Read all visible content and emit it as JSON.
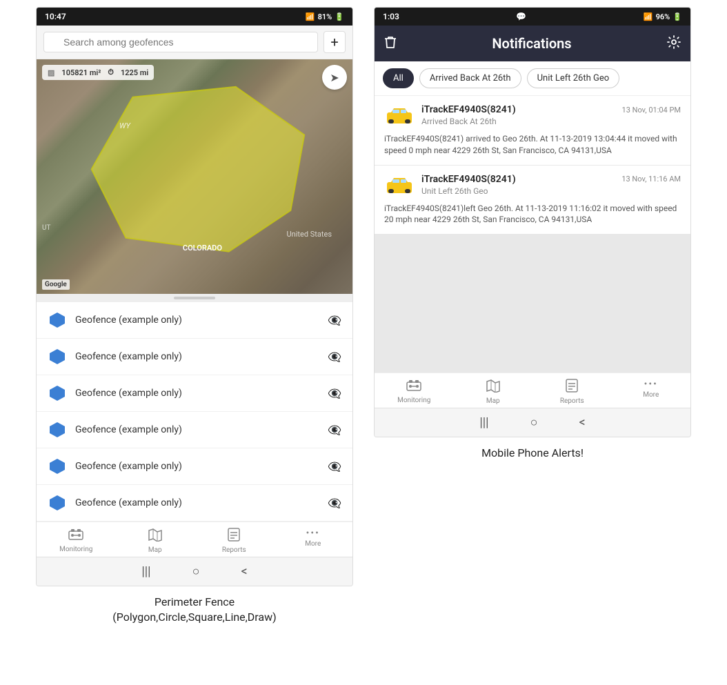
{
  "left_phone": {
    "status_bar": {
      "time": "10:47",
      "wifi": "WiFi",
      "signal": "📶",
      "battery": "81%"
    },
    "search": {
      "placeholder": "Search among geofences",
      "add_button": "+"
    },
    "map": {
      "area": "105821 mi²",
      "distance": "1225 mi",
      "label_wy": "WY",
      "label_ut": "UT",
      "label_us": "United States",
      "label_colorado": "COLORADO",
      "google": "Google"
    },
    "geofence_items": [
      {
        "label": "Geofence (example only)"
      },
      {
        "label": "Geofence (example only)"
      },
      {
        "label": "Geofence (example only)"
      },
      {
        "label": "Geofence (example only)"
      },
      {
        "label": "Geofence (example only)"
      },
      {
        "label": "Geofence (example only)"
      }
    ],
    "bottom_nav": [
      {
        "label": "Monitoring",
        "icon": "🚌"
      },
      {
        "label": "Map",
        "icon": "🗺"
      },
      {
        "label": "Reports",
        "icon": "📊"
      },
      {
        "label": "More",
        "icon": "•••"
      }
    ],
    "android_nav": [
      "|||",
      "○",
      "<"
    ],
    "caption": "Perimeter Fence\n(Polygon,Circle,Square,Line,Draw)"
  },
  "right_phone": {
    "status_bar": {
      "time": "1:03",
      "chat_icon": "💬",
      "wifi": "WiFi",
      "signal": "📶",
      "battery": "96%"
    },
    "header": {
      "title": "Notifications",
      "delete_icon": "trash",
      "settings_icon": "gear"
    },
    "filters": [
      {
        "label": "All",
        "active": true
      },
      {
        "label": "Arrived Back At 26th",
        "active": false
      },
      {
        "label": "Unit Left 26th Geo",
        "active": false
      }
    ],
    "notifications": [
      {
        "device": "iTrackEF4940S(8241)",
        "time": "13 Nov, 01:04 PM",
        "subtitle": "Arrived Back At 26th",
        "body": "iTrackEF4940S(8241) arrived to Geo 26th.    At 11-13-2019 13:04:44 it moved with speed 0 mph near 4229 26th St, San Francisco, CA 94131,USA"
      },
      {
        "device": "iTrackEF4940S(8241)",
        "time": "13 Nov, 11:16 AM",
        "subtitle": "Unit Left 26th Geo",
        "body": "iTrackEF4940S(8241)left Geo 26th.   At 11-13-2019 11:16:02 it moved with speed 20 mph near 4229 26th St, San Francisco, CA 94131,USA"
      }
    ],
    "bottom_nav": [
      {
        "label": "Monitoring",
        "icon": "🚌"
      },
      {
        "label": "Map",
        "icon": "🗺"
      },
      {
        "label": "Reports",
        "icon": "📊"
      },
      {
        "label": "More",
        "icon": "•••"
      }
    ],
    "android_nav": [
      "|||",
      "○",
      "<"
    ],
    "caption": "Mobile Phone Alerts!"
  }
}
